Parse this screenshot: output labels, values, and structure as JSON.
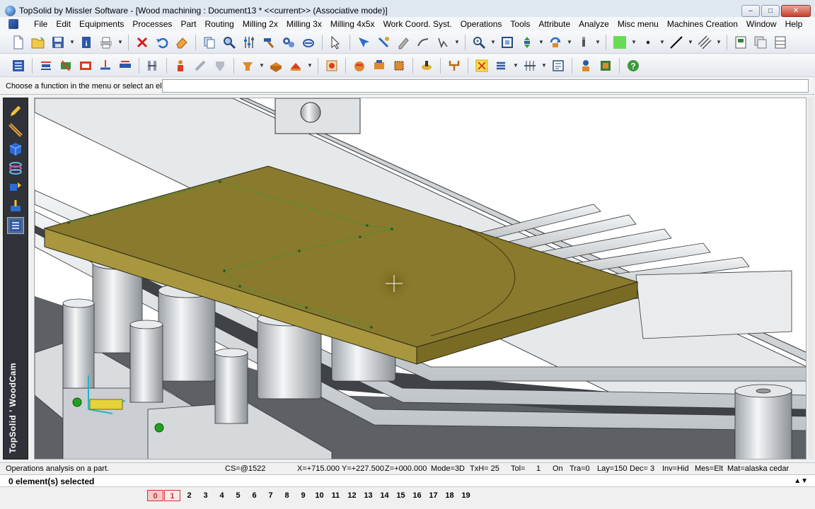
{
  "window": {
    "title": "TopSolid by Missler Software - [Wood machining : Document13 *  <<current>> (Associative mode)]",
    "buttons": {
      "minimize": "–",
      "maximize": "□",
      "close": "✕"
    }
  },
  "menu": [
    "File",
    "Edit",
    "Equipments",
    "Processes",
    "Part",
    "Routing",
    "Milling 2x",
    "Milling 3x",
    "Milling 4x5x",
    "Work Coord. Syst.",
    "Operations",
    "Tools",
    "Attribute",
    "Analyze",
    "Misc menu",
    "Machines Creation",
    "Window",
    "Help"
  ],
  "toolbar1_icons": [
    "new-file-icon",
    "open-file-icon",
    "save-icon",
    "info-icon",
    "print-icon",
    "delete-icon",
    "undo-icon",
    "eraser-icon",
    "copy-icon",
    "search-icon",
    "settings-icon",
    "hammer-icon",
    "gears-icon",
    "cancel-icon",
    "pointer-icon",
    "cursor-icon",
    "query-icon",
    "pen-icon",
    "sketch-icon",
    "zoom-icon",
    "fit-icon",
    "move-icon",
    "rotate-icon",
    "pen-light-icon",
    "color-swatch-icon",
    "point-icon",
    "line-icon",
    "hatch-icon",
    "window-icon",
    "copy-window-icon",
    "tile-icon"
  ],
  "toolbar2_icons": [
    "layers-icon",
    "align-icon",
    "tools-icon",
    "pocket-icon",
    "drill-icon",
    "plate-icon",
    "filter-icon",
    "person-icon",
    "lock-icon",
    "hand-icon",
    "shape-icon",
    "solid-icon",
    "stock-icon",
    "machine-icon",
    "clamp-icon",
    "frame-icon",
    "cube-icon",
    "spindle-icon",
    "bracket-icon",
    "setup-icon",
    "crop-icon",
    "list-icon",
    "grid-icon",
    "sheet-icon",
    "user-icon",
    "report-icon",
    "help-icon"
  ],
  "colors": {
    "swatch": "#66dd55",
    "board": "#8a7a2e",
    "rail": "#dfe3e6",
    "titlebar": "#dfe7f1",
    "leftbar": "#2f3238"
  },
  "prompt": {
    "label": "Choose a function in the menu or select an element:",
    "value": ""
  },
  "leftbar": {
    "tools": [
      "pencil-icon",
      "ruler-icon",
      "cube-icon",
      "coil-icon",
      "transform-icon",
      "machine-icon",
      "toolpath-icon"
    ],
    "brand": "TopSolid ' WoodCam"
  },
  "status": {
    "message": "Operations analysis on a part.",
    "cs": "CS=@1522",
    "x": "X=+715.000",
    "y": "Y=+227.500",
    "z": "Z=+000.000",
    "mode": "Mode=3D",
    "txh": "TxH= 25",
    "tol": "Tol=",
    "tol_val": "1",
    "on": "On",
    "tra": "Tra=0",
    "lay": "Lay=150",
    "dec": "Dec= 3",
    "inv": "Inv=Hid",
    "mes": "Mes=Elt",
    "mat": "Mat=alaska cedar"
  },
  "selection": {
    "text": "0 element(s) selected",
    "scroll_glyph": "▲▼"
  },
  "layers": [
    "0",
    "1",
    "2",
    "3",
    "4",
    "5",
    "6",
    "7",
    "8",
    "9",
    "10",
    "11",
    "12",
    "13",
    "14",
    "15",
    "16",
    "17",
    "18",
    "19"
  ]
}
